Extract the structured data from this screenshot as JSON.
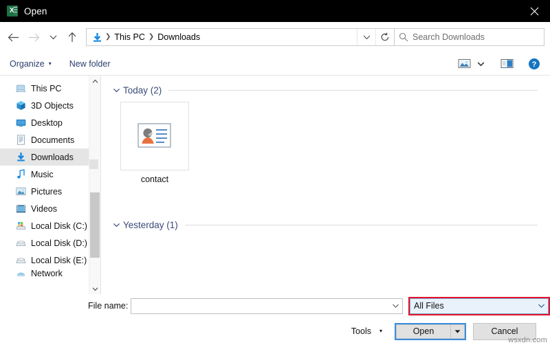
{
  "window": {
    "title": "Open",
    "app_icon": "excel-icon",
    "close_label": "✕"
  },
  "nav": {
    "back_icon": "back-arrow-icon",
    "forward_icon": "forward-arrow-icon",
    "recent_icon": "recent-locations-chevron-icon",
    "up_icon": "up-arrow-icon",
    "location_icon": "downloads-folder-icon",
    "breadcrumbs": [
      "This PC",
      "Downloads"
    ],
    "separator": "›",
    "dropdown_icon": "chevron-down-icon",
    "refresh_icon": "refresh-icon"
  },
  "search": {
    "icon": "search-icon",
    "placeholder": "Search Downloads",
    "value": ""
  },
  "toolbar": {
    "organize_label": "Organize",
    "organize_caret": "▾",
    "new_folder_label": "New folder",
    "view_icon": "view-mode-icon",
    "view_caret": "▾",
    "preview_pane_icon": "preview-pane-icon",
    "help_icon": "help-icon",
    "help_glyph": "?"
  },
  "sidebar": {
    "items": [
      {
        "label": "This PC",
        "icon": "this-pc-icon",
        "selected": false
      },
      {
        "label": "3D Objects",
        "icon": "3d-objects-icon",
        "selected": false
      },
      {
        "label": "Desktop",
        "icon": "desktop-icon",
        "selected": false
      },
      {
        "label": "Documents",
        "icon": "documents-icon",
        "selected": false
      },
      {
        "label": "Downloads",
        "icon": "downloads-icon",
        "selected": true
      },
      {
        "label": "Music",
        "icon": "music-icon",
        "selected": false
      },
      {
        "label": "Pictures",
        "icon": "pictures-icon",
        "selected": false
      },
      {
        "label": "Videos",
        "icon": "videos-icon",
        "selected": false
      },
      {
        "label": "Local Disk (C:)",
        "icon": "system-drive-icon",
        "selected": false
      },
      {
        "label": "Local Disk (D:)",
        "icon": "drive-icon",
        "selected": false
      },
      {
        "label": "Local Disk (E:)",
        "icon": "drive-icon",
        "selected": false
      },
      {
        "label": "Network",
        "icon": "network-icon",
        "selected": false
      }
    ],
    "scroll_up_icon": "scroll-up-arrow-icon",
    "scroll_down_icon": "scroll-down-arrow-icon"
  },
  "files": {
    "groups": [
      {
        "title": "Today (2)",
        "chevron": "collapse-chevron-icon",
        "items": [
          {
            "name": "contact",
            "icon": "contact-card-icon"
          }
        ]
      },
      {
        "title": "Yesterday (1)",
        "chevron": "collapse-chevron-icon",
        "items": []
      }
    ]
  },
  "footer": {
    "filename_label": "File name:",
    "filename_value": "",
    "filename_dropdown_icon": "chevron-down-icon",
    "filter_value": "All Files",
    "filter_dropdown_icon": "chevron-down-icon",
    "tools_label": "Tools",
    "tools_caret": "▾",
    "open_label": "Open",
    "open_split_icon": "chevron-down-icon",
    "cancel_label": "Cancel"
  },
  "watermark": "wsxdn.com",
  "colors": {
    "titlebar_bg": "#000000",
    "accent_blue": "#3a8ddb",
    "highlight_red": "#e4122b",
    "filter_fill": "#e9f2fb",
    "group_title": "#3b4a77",
    "toolbar_text": "#2c3e6b",
    "selected_row": "#e5e5e5"
  }
}
